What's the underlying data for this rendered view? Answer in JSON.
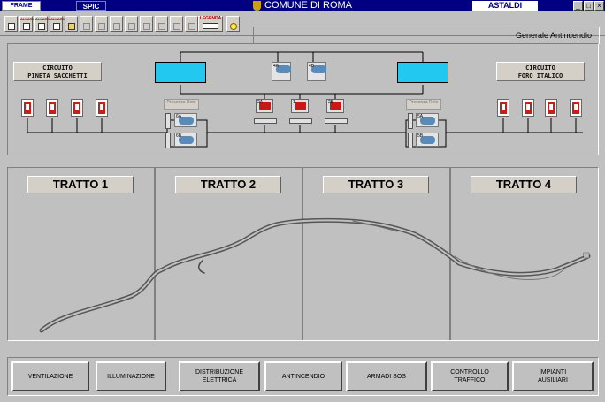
{
  "window": {
    "logo": "FRAME",
    "app": "SPIC",
    "title": "COMUNE DI ROMA",
    "company": "ASTALDI",
    "controls": [
      "_",
      "□",
      "×"
    ]
  },
  "toolbar": {
    "allarmi_label": "ALLARMI",
    "legenda_label": "LEGENDA",
    "section_title": "Generale Antincendio"
  },
  "schematic": {
    "circuit_left": "CIRCUITO\nPINETA SACCHETTI",
    "circuit_right": "CIRCUITO\nFORO ITALICO",
    "presenza_label": "Presenza Rete",
    "pump_labels": {
      "p4a": "4A",
      "p4b": "4B",
      "p2a": "2A",
      "p1": "1",
      "p2b": "2B",
      "p6a": "6A",
      "p6b": "6B",
      "p5a": "5A",
      "p5b": "5B"
    }
  },
  "tratti": [
    {
      "label": "TRATTO 1"
    },
    {
      "label": "TRATTO 2"
    },
    {
      "label": "TRATTO 3"
    },
    {
      "label": "TRATTO 4"
    }
  ],
  "nav": [
    {
      "label": "VENTILAZIONE"
    },
    {
      "label": "ILLUMINAZIONE"
    },
    {
      "label": "DISTRIBUZIONE\nELETTRICA"
    },
    {
      "label": "ANTINCENDIO"
    },
    {
      "label": "ARMADI SOS"
    },
    {
      "label": "CONTROLLO\nTRAFFICO"
    },
    {
      "label": "IMPIANTI\nAUSILIARI"
    }
  ]
}
